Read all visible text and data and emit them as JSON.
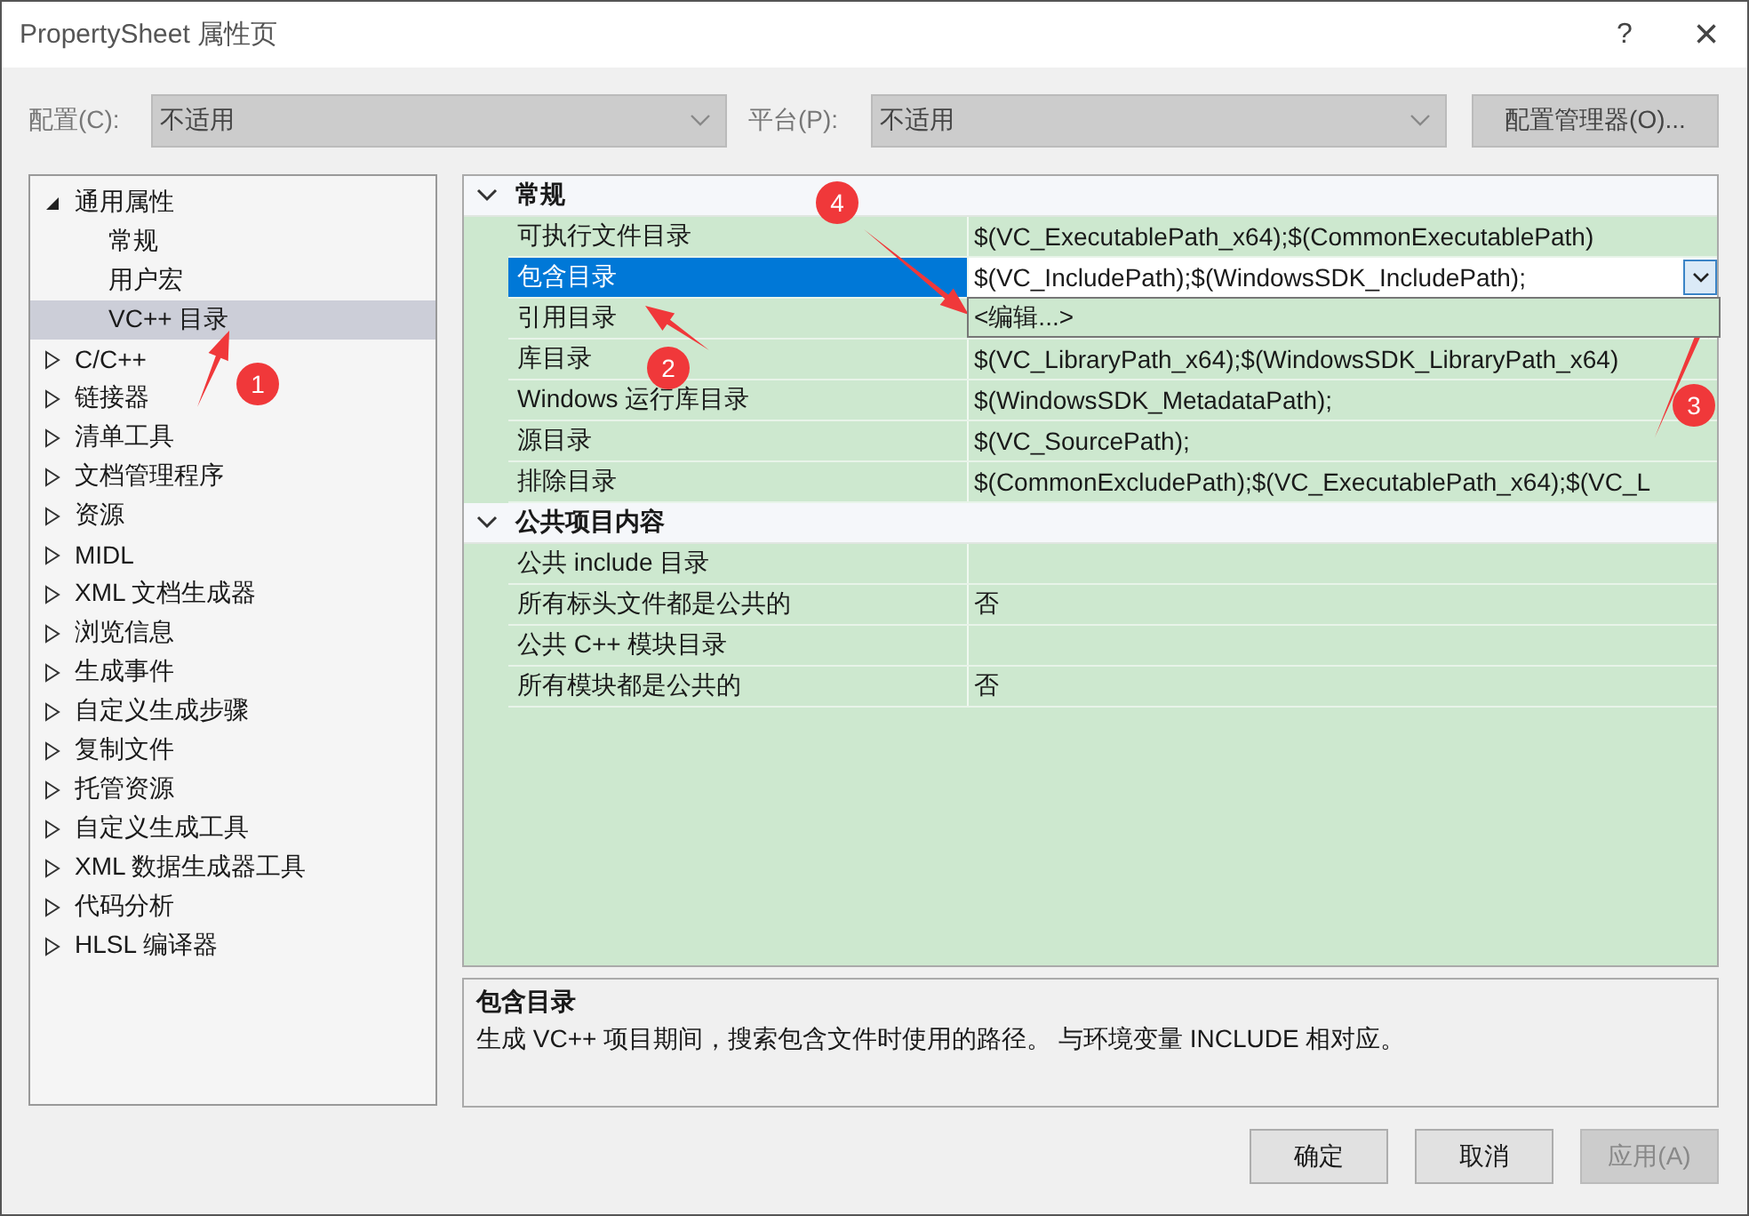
{
  "window": {
    "title": "PropertySheet 属性页",
    "help": "?",
    "close": "×"
  },
  "config_bar": {
    "configuration": {
      "label": "配置(C):",
      "value": "不适用",
      "disabled": true
    },
    "platform": {
      "label": "平台(P):",
      "value": "不适用",
      "disabled": true
    },
    "manager_button": "配置管理器(O)..."
  },
  "tree": [
    {
      "label": "通用属性",
      "expanded": true,
      "selected": false,
      "children": [
        {
          "label": "常规",
          "selected": false
        },
        {
          "label": "用户宏",
          "selected": false
        },
        {
          "label": "VC++ 目录",
          "selected": true
        }
      ]
    },
    {
      "label": "C/C++",
      "expanded": false,
      "selected": false
    },
    {
      "label": "链接器",
      "expanded": false,
      "selected": false
    },
    {
      "label": "清单工具",
      "expanded": false,
      "selected": false
    },
    {
      "label": "文档管理程序",
      "expanded": false,
      "selected": false
    },
    {
      "label": "资源",
      "expanded": false,
      "selected": false
    },
    {
      "label": "MIDL",
      "expanded": false,
      "selected": false
    },
    {
      "label": "XML 文档生成器",
      "expanded": false,
      "selected": false
    },
    {
      "label": "浏览信息",
      "expanded": false,
      "selected": false
    },
    {
      "label": "生成事件",
      "expanded": false,
      "selected": false
    },
    {
      "label": "自定义生成步骤",
      "expanded": false,
      "selected": false
    },
    {
      "label": "复制文件",
      "expanded": false,
      "selected": false
    },
    {
      "label": "托管资源",
      "expanded": false,
      "selected": false
    },
    {
      "label": "自定义生成工具",
      "expanded": false,
      "selected": false
    },
    {
      "label": "XML 数据生成器工具",
      "expanded": false,
      "selected": false
    },
    {
      "label": "代码分析",
      "expanded": false,
      "selected": false
    },
    {
      "label": "HLSL 编译器",
      "expanded": false,
      "selected": false
    }
  ],
  "grid": {
    "categories": [
      {
        "title": "常规",
        "expanded": true,
        "rows": [
          {
            "name": "可执行文件目录",
            "value": "$(VC_ExecutablePath_x64);$(CommonExecutablePath)",
            "selected": false
          },
          {
            "name": "包含目录",
            "value": "$(VC_IncludePath);$(WindowsSDK_IncludePath);",
            "selected": true
          },
          {
            "name": "引用目录",
            "selected": false
          },
          {
            "name": "库目录",
            "value": "$(VC_LibraryPath_x64);$(WindowsSDK_LibraryPath_x64)",
            "selected": false
          },
          {
            "name": "Windows 运行库目录",
            "value": "$(WindowsSDK_MetadataPath);",
            "selected": false
          },
          {
            "name": "源目录",
            "value": "$(VC_SourcePath);",
            "selected": false
          },
          {
            "name": "排除目录",
            "value": "$(CommonExcludePath);$(VC_ExecutablePath_x64);$(VC_L",
            "selected": false
          }
        ]
      },
      {
        "title": "公共项目内容",
        "expanded": true,
        "rows": [
          {
            "name": "公共 include 目录",
            "selected": false
          },
          {
            "name": "所有标头文件都是公共的",
            "value": "否",
            "selected": false
          },
          {
            "name": "公共 C++ 模块目录",
            "selected": false
          },
          {
            "name": "所有模块都是公共的",
            "value": "否",
            "selected": false
          }
        ]
      }
    ],
    "dropdown_options": [
      "<编辑...>"
    ]
  },
  "description": {
    "title": "包含目录",
    "text": "生成 VC++ 项目期间，搜索包含文件时使用的路径。 与环境变量 INCLUDE 相对应。"
  },
  "buttons": [
    {
      "label": "确定",
      "disabled": false
    },
    {
      "label": "取消",
      "disabled": false
    },
    {
      "label": "应用(A)",
      "disabled": true
    }
  ],
  "annotations": [
    {
      "number": "1"
    },
    {
      "number": "2"
    },
    {
      "number": "3"
    },
    {
      "number": "4"
    }
  ]
}
